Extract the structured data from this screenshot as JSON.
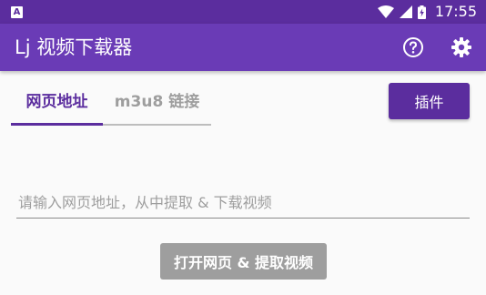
{
  "status_bar": {
    "time": "17:55",
    "left_icon": "A",
    "icons": [
      "notification-a-icon",
      "wifi-icon",
      "signal-icon",
      "battery-charging-icon"
    ]
  },
  "app_bar": {
    "title": "Lj 视频下载器",
    "actions": [
      "help-icon",
      "settings-gear-icon"
    ],
    "color": "#6a3bb6"
  },
  "tabs": [
    {
      "label": "网页地址",
      "active": true
    },
    {
      "label": "m3u8 链接",
      "active": false
    }
  ],
  "plugin_button": {
    "label": "插件"
  },
  "url_field": {
    "value": "",
    "placeholder": "请输入网页地址，从中提取 & 下载视频"
  },
  "open_button": {
    "label": "打开网页 & 提取视频"
  },
  "colors": {
    "status_bar": "#5b2d9e",
    "accent": "#5b2d9e",
    "disabled_button": "#9e9e9e",
    "background": "#fafafa"
  }
}
